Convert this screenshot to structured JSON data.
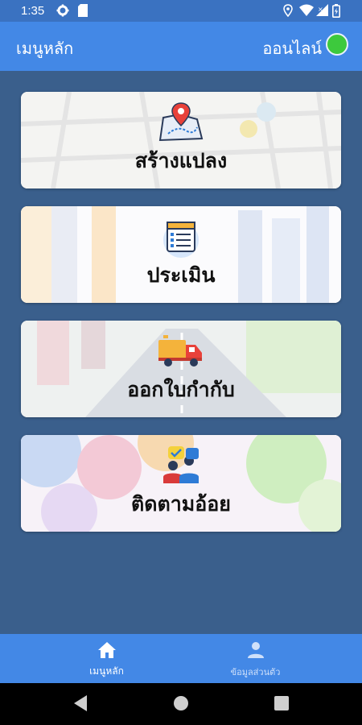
{
  "status_bar": {
    "time": "1:35",
    "icons": [
      "gear-icon",
      "sim-card-icon",
      "location-icon",
      "wifi-icon",
      "signal-icon",
      "battery-icon"
    ]
  },
  "app_bar": {
    "title": "เมนูหลัก",
    "status_text": "ออนไลน์",
    "status_color": "#3dc93d"
  },
  "menu": {
    "items": [
      {
        "label": "สร้างแปลง",
        "icon": "map-pin-icon"
      },
      {
        "label": "ประเมิน",
        "icon": "checklist-icon"
      },
      {
        "label": "ออกใบกำกับ",
        "icon": "truck-icon"
      },
      {
        "label": "ติดตามอ้อย",
        "icon": "people-icon"
      }
    ]
  },
  "bottom_nav": {
    "items": [
      {
        "label": "เมนูหลัก",
        "icon": "home-icon",
        "active": true
      },
      {
        "label": "ข้อมูลส่วนตัว",
        "icon": "person-icon",
        "active": false
      }
    ]
  },
  "colors": {
    "primary": "#4388e6",
    "background": "#3a5f8c",
    "active_nav": "#ffffff",
    "inactive_nav": "#cfe0fa"
  }
}
